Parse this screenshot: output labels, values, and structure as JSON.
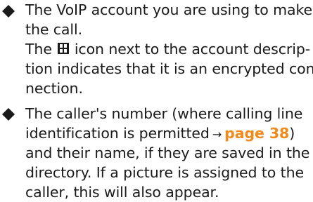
{
  "items": [
    {
      "part1": "The VoIP account you are using to make",
      "part2": "the call.",
      "part3a": "The",
      "lock_icon": "encrypted-lock-icon",
      "part3b": "icon next to the account descrip-",
      "part4": "tion indicates that it is an encrypted con-",
      "part5": "nection."
    },
    {
      "part1": "The caller's number (where calling line",
      "part2a": "identification is permitted",
      "arrow": "→",
      "link": "page 38",
      "part2b": ")",
      "part3": "and their name, if they are saved in the",
      "part4": "directory. If a picture is assigned to the",
      "part5": "caller, this will also appear."
    }
  ],
  "colors": {
    "text": "#1a1a1a",
    "link": "#f08a1c"
  },
  "bullet_icon": "diamond-bullet-icon"
}
